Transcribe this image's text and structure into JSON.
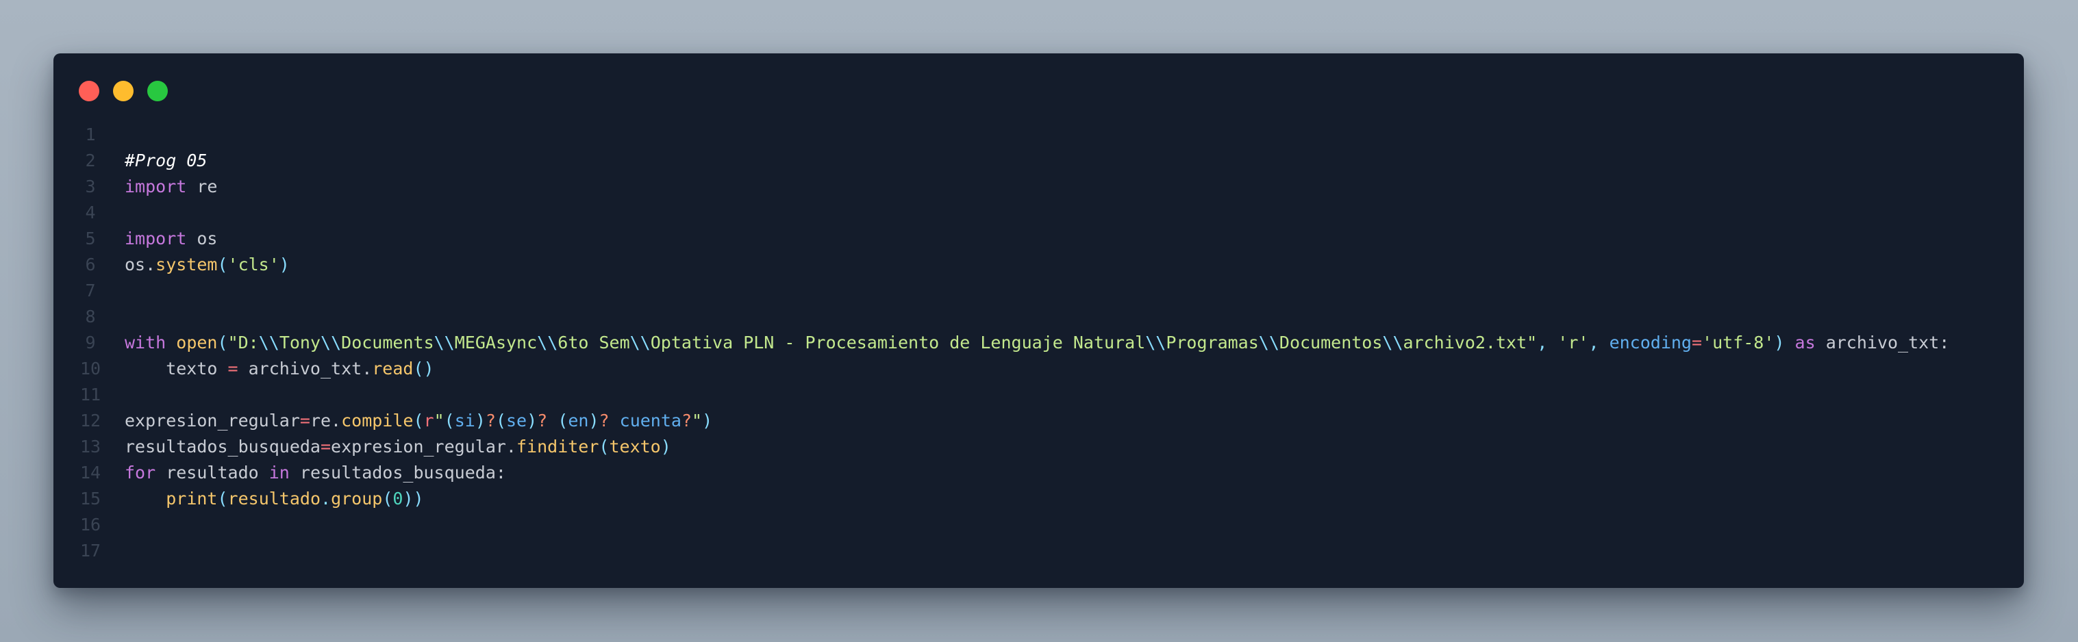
{
  "window": {
    "controls": {
      "close_color": "#ff5f57",
      "minimize_color": "#febc2e",
      "maximize_color": "#28c840"
    },
    "background": "#141c2b"
  },
  "code": {
    "language": "python",
    "lines": [
      {
        "n": "1",
        "tokens": []
      },
      {
        "n": "2",
        "tokens": [
          {
            "t": "comment",
            "v": "#Prog 05"
          }
        ]
      },
      {
        "n": "3",
        "tokens": [
          {
            "t": "keyword",
            "v": "import"
          },
          {
            "t": "default",
            "v": " re"
          }
        ]
      },
      {
        "n": "4",
        "tokens": []
      },
      {
        "n": "5",
        "tokens": [
          {
            "t": "keyword",
            "v": "import"
          },
          {
            "t": "default",
            "v": " os"
          }
        ]
      },
      {
        "n": "6",
        "tokens": [
          {
            "t": "default",
            "v": "os."
          },
          {
            "t": "func",
            "v": "system"
          },
          {
            "t": "punct",
            "v": "("
          },
          {
            "t": "string",
            "v": "'cls'"
          },
          {
            "t": "punct",
            "v": ")"
          }
        ]
      },
      {
        "n": "7",
        "tokens": []
      },
      {
        "n": "8",
        "tokens": []
      },
      {
        "n": "9",
        "tokens": [
          {
            "t": "keyword",
            "v": "with"
          },
          {
            "t": "default",
            "v": " "
          },
          {
            "t": "func",
            "v": "open"
          },
          {
            "t": "punct",
            "v": "("
          },
          {
            "t": "string",
            "v": "\"D:"
          },
          {
            "t": "escape",
            "v": "\\\\"
          },
          {
            "t": "string",
            "v": "Tony"
          },
          {
            "t": "escape",
            "v": "\\\\"
          },
          {
            "t": "string",
            "v": "Documents"
          },
          {
            "t": "escape",
            "v": "\\\\"
          },
          {
            "t": "string",
            "v": "MEGAsync"
          },
          {
            "t": "escape",
            "v": "\\\\"
          },
          {
            "t": "string",
            "v": "6to Sem"
          },
          {
            "t": "escape",
            "v": "\\\\"
          },
          {
            "t": "string",
            "v": "Optativa PLN - Procesamiento de Lenguaje Natural"
          },
          {
            "t": "escape",
            "v": "\\\\"
          },
          {
            "t": "string",
            "v": "Programas"
          },
          {
            "t": "escape",
            "v": "\\\\"
          },
          {
            "t": "string",
            "v": "Documentos"
          },
          {
            "t": "escape",
            "v": "\\\\"
          },
          {
            "t": "string",
            "v": "archivo2.txt\""
          },
          {
            "t": "punct",
            "v": ", "
          },
          {
            "t": "string",
            "v": "'r'"
          },
          {
            "t": "punct",
            "v": ", "
          },
          {
            "t": "param",
            "v": "encoding"
          },
          {
            "t": "op",
            "v": "="
          },
          {
            "t": "string",
            "v": "'utf-8'"
          },
          {
            "t": "punct",
            "v": ")"
          },
          {
            "t": "default",
            "v": " "
          },
          {
            "t": "keyword",
            "v": "as"
          },
          {
            "t": "default",
            "v": " archivo_txt:"
          }
        ]
      },
      {
        "n": "10",
        "tokens": [
          {
            "t": "default",
            "v": "    texto "
          },
          {
            "t": "op",
            "v": "="
          },
          {
            "t": "default",
            "v": " archivo_txt."
          },
          {
            "t": "func",
            "v": "read"
          },
          {
            "t": "punct",
            "v": "()"
          }
        ]
      },
      {
        "n": "11",
        "tokens": []
      },
      {
        "n": "12",
        "tokens": [
          {
            "t": "default",
            "v": "expresion_regular"
          },
          {
            "t": "op",
            "v": "="
          },
          {
            "t": "default",
            "v": "re."
          },
          {
            "t": "func",
            "v": "compile"
          },
          {
            "t": "punct",
            "v": "("
          },
          {
            "t": "op",
            "v": "r"
          },
          {
            "t": "string",
            "v": "\""
          },
          {
            "t": "punct",
            "v": "("
          },
          {
            "t": "regex",
            "v": "si"
          },
          {
            "t": "punct",
            "v": ")"
          },
          {
            "t": "regexq",
            "v": "?"
          },
          {
            "t": "punct",
            "v": "("
          },
          {
            "t": "regex",
            "v": "se"
          },
          {
            "t": "punct",
            "v": ")"
          },
          {
            "t": "regexq",
            "v": "?"
          },
          {
            "t": "regex",
            "v": " "
          },
          {
            "t": "punct",
            "v": "("
          },
          {
            "t": "regex",
            "v": "en"
          },
          {
            "t": "punct",
            "v": ")"
          },
          {
            "t": "regexq",
            "v": "?"
          },
          {
            "t": "regex",
            "v": " cuenta"
          },
          {
            "t": "regexq",
            "v": "?"
          },
          {
            "t": "string",
            "v": "\""
          },
          {
            "t": "punct",
            "v": ")"
          }
        ]
      },
      {
        "n": "13",
        "tokens": [
          {
            "t": "default",
            "v": "resultados_busqueda"
          },
          {
            "t": "op",
            "v": "="
          },
          {
            "t": "default",
            "v": "expresion_regular."
          },
          {
            "t": "func",
            "v": "finditer"
          },
          {
            "t": "punct",
            "v": "("
          },
          {
            "t": "func",
            "v": "texto"
          },
          {
            "t": "punct",
            "v": ")"
          }
        ]
      },
      {
        "n": "14",
        "tokens": [
          {
            "t": "keyword",
            "v": "for"
          },
          {
            "t": "default",
            "v": " resultado "
          },
          {
            "t": "keyword",
            "v": "in"
          },
          {
            "t": "default",
            "v": " resultados_busqueda:"
          }
        ]
      },
      {
        "n": "15",
        "tokens": [
          {
            "t": "default",
            "v": "    "
          },
          {
            "t": "func",
            "v": "print"
          },
          {
            "t": "punct",
            "v": "("
          },
          {
            "t": "func",
            "v": "resultado"
          },
          {
            "t": "punct",
            "v": "."
          },
          {
            "t": "func",
            "v": "group"
          },
          {
            "t": "punct",
            "v": "("
          },
          {
            "t": "number",
            "v": "0"
          },
          {
            "t": "punct",
            "v": "))"
          }
        ]
      },
      {
        "n": "16",
        "tokens": []
      },
      {
        "n": "17",
        "tokens": []
      }
    ]
  }
}
